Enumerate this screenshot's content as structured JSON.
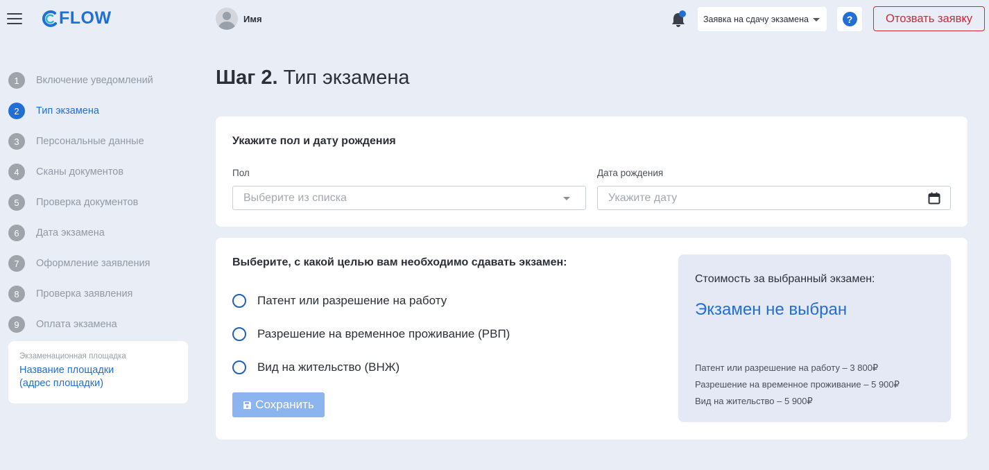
{
  "header": {
    "logo_text": "FLOW",
    "user_name": "Имя",
    "application_select": "Заявка на сдачу экзамена",
    "help_symbol": "?",
    "revoke_label": "Отозвать заявку"
  },
  "sidebar": {
    "steps": [
      {
        "num": "1",
        "label": "Включение уведомлений"
      },
      {
        "num": "2",
        "label": "Тип экзамена"
      },
      {
        "num": "3",
        "label": "Персональные данные"
      },
      {
        "num": "4",
        "label": "Сканы документов"
      },
      {
        "num": "5",
        "label": "Проверка документов"
      },
      {
        "num": "6",
        "label": "Дата экзамена"
      },
      {
        "num": "7",
        "label": "Оформление заявления"
      },
      {
        "num": "8",
        "label": "Проверка заявления"
      },
      {
        "num": "9",
        "label": "Оплата экзамена"
      }
    ],
    "active_step": 2,
    "venue": {
      "caption": "Экзаменационная площадка",
      "name": "Название площадки",
      "address": "(адрес площадки)"
    }
  },
  "main": {
    "title_bold": "Шаг 2.",
    "title_rest": "Тип экзамена",
    "gender_card": {
      "title": "Укажите пол и дату рождения",
      "gender_label": "Пол",
      "gender_placeholder": "Выберите из списка",
      "birth_label": "Дата рождения",
      "birth_placeholder": "Укажите дату"
    },
    "purpose_card": {
      "title": "Выберите, с какой целью вам необходимо сдавать экзамен:",
      "options": [
        "Патент или разрешение на работу",
        "Разрешение на временное проживание (РВП)",
        "Вид на жительство (ВНЖ)"
      ],
      "save_label": "Сохранить",
      "price": {
        "title": "Стоимость за выбранный экзамен:",
        "status": "Экзамен не выбран",
        "list": [
          "Патент или разрешение на работу – 3 800₽",
          "Разрешение на временное проживание – 5 900₽",
          "Вид на жительство – 5 900₽"
        ]
      }
    }
  },
  "colors": {
    "accent": "#1f6fd6",
    "danger": "#d6243a",
    "background": "#e9edf6",
    "save_disabled": "#8cb4ef"
  }
}
